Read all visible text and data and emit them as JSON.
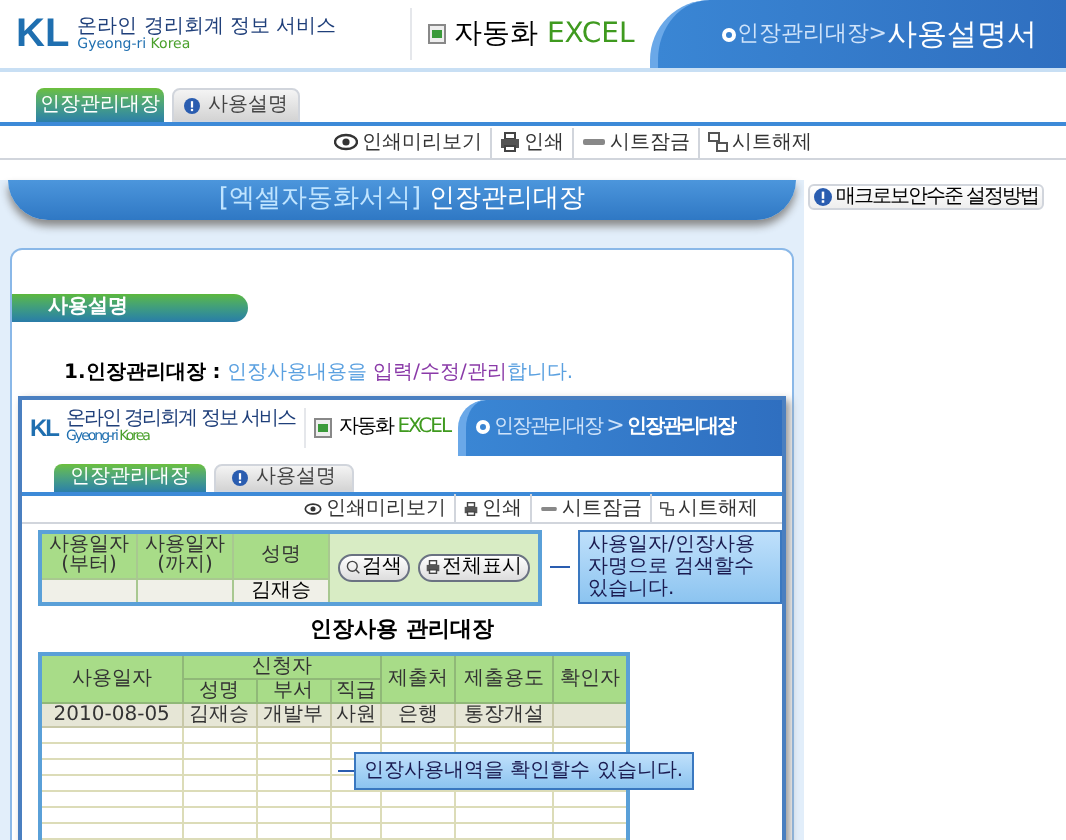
{
  "header": {
    "logo": {
      "mark": "KL",
      "line1": "온라인 경리회계 정보 서비스",
      "line2a": "Gyeong-ri",
      "line2b": "Korea"
    },
    "product": {
      "name": "자동화",
      "suffix": "EXCEL"
    },
    "breadcrumb": {
      "parent": "인장관리대장",
      "separator": ">",
      "current": "사용설명서"
    }
  },
  "tabs": [
    {
      "label": "인장관리대장",
      "selected": true,
      "kind": "plain"
    },
    {
      "label": "사용설명",
      "selected": false,
      "kind": "help"
    }
  ],
  "toolbar": [
    {
      "label": "인쇄미리보기",
      "kind": "preview"
    },
    {
      "label": "인쇄",
      "kind": "print"
    },
    {
      "label": "시트잠금",
      "kind": "lock"
    },
    {
      "label": "시트해제",
      "kind": "unlock"
    }
  ],
  "banner": {
    "prefix": "[엑셀자동화서식]",
    "title": "인장관리대장"
  },
  "side_button": "매크로보안수준 설정방법",
  "section_title": "사용설명",
  "description": [
    {
      "text": "1.인장관리대장 :",
      "kind": "lead"
    },
    {
      "text": " 인장사용내용을 ",
      "kind": "plain"
    },
    {
      "text": "입력/수정/관리",
      "kind": "emphasis"
    },
    {
      "text": "합니다.",
      "kind": "plain"
    }
  ],
  "screenshot": {
    "header": {
      "logo": {
        "mark": "KL",
        "line1": "온라인 경리회계 정보 서비스",
        "line2a": "Gyeong-ri",
        "line2b": "Korea"
      },
      "product": {
        "name": "자동화",
        "suffix": "EXCEL"
      },
      "breadcrumb": {
        "parent": "인장관리대장",
        "separator": ">",
        "current": "인장관리대장"
      }
    },
    "tabs": [
      {
        "label": "인장관리대장",
        "selected": true,
        "kind": "plain"
      },
      {
        "label": "사용설명",
        "selected": false,
        "kind": "help"
      }
    ],
    "toolbar": [
      {
        "label": "인쇄미리보기",
        "kind": "preview"
      },
      {
        "label": "인쇄",
        "kind": "print"
      },
      {
        "label": "시트잠금",
        "kind": "lock"
      },
      {
        "label": "시트해제",
        "kind": "unlock"
      }
    ],
    "search": {
      "columns": [
        {
          "label": "사용일자",
          "sub": "(부터)"
        },
        {
          "label": "사용일자",
          "sub": "(까지)"
        },
        {
          "label": "성명",
          "value": "김재승"
        }
      ],
      "buttons": [
        {
          "label": "검색",
          "kind": "search"
        },
        {
          "label": "전체표시",
          "kind": "print"
        }
      ]
    },
    "search_note": "사용일자/인장사용자명으로 검색할수 있습니다.",
    "title": "인장사용 관리대장",
    "table": {
      "header_rows": [
        [
          {
            "label": "사용일자",
            "rowspan": 2
          },
          {
            "label": "신청자",
            "colspan": 3
          },
          {
            "label": "제출처",
            "rowspan": 2
          },
          {
            "label": "제출용도",
            "rowspan": 2
          },
          {
            "label": "확인자",
            "rowspan": 2
          }
        ],
        [
          {
            "label": "성명"
          },
          {
            "label": "부서"
          },
          {
            "label": "직급"
          }
        ]
      ],
      "rows": [
        [
          "2010-08-05",
          "김재승",
          "개발부",
          "사원",
          "은행",
          "통장개설"
        ]
      ]
    },
    "table_note": "인장사용내역을 확인할수 있습니다."
  }
}
